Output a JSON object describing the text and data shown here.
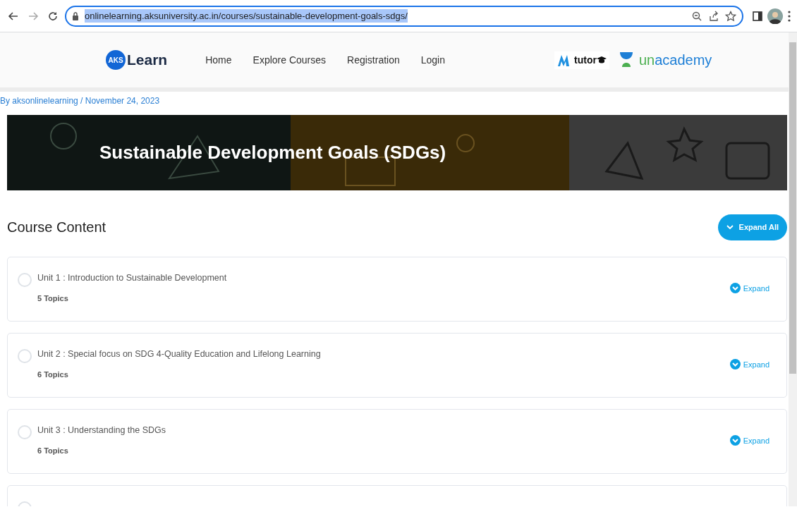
{
  "browser": {
    "url": "onlinelearning.aksuniversity.ac.in/courses/sustainable-development-goals-sdgs/",
    "url_selected": true
  },
  "site_header": {
    "logo_badge": "AKS",
    "logo_text": "Learn",
    "nav": [
      {
        "label": "Home"
      },
      {
        "label": "Explore Courses"
      },
      {
        "label": "Registration"
      },
      {
        "label": "Login"
      }
    ],
    "partner_logos": [
      {
        "kind": "mtutor",
        "text": "tutor"
      },
      {
        "kind": "unacademy",
        "text_green": "un",
        "text_blue": "academy"
      }
    ]
  },
  "byline": "By aksonlinelearning / November 24, 2023",
  "banner": {
    "title": "Sustainable Development Goals (SDGs)"
  },
  "course_content": {
    "heading": "Course Content",
    "expand_all": "Expand All",
    "units": [
      {
        "title": "Unit 1 : Introduction to Sustainable Development",
        "topics": "5 Topics",
        "expand": "Expand",
        "completed": false
      },
      {
        "title": "Unit 2 : Special focus on SDG 4-Quality Education and Lifelong Learning",
        "topics": "6 Topics",
        "expand": "Expand",
        "completed": false
      },
      {
        "title": "Unit 3 : Understanding the SDGs",
        "topics": "6 Topics",
        "expand": "Expand",
        "completed": false
      },
      {
        "completed": false
      }
    ]
  }
}
